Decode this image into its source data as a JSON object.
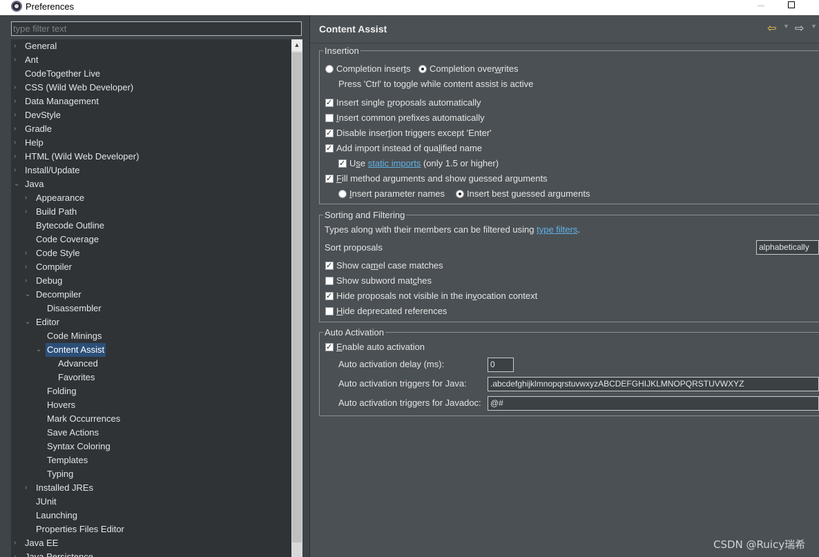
{
  "window": {
    "title": "Preferences"
  },
  "filter": {
    "placeholder": "type filter text"
  },
  "tree": [
    {
      "label": "General",
      "level": 0,
      "arrow": "›"
    },
    {
      "label": "Ant",
      "level": 0,
      "arrow": "›"
    },
    {
      "label": "CodeTogether Live",
      "level": 0,
      "arrow": ""
    },
    {
      "label": "CSS (Wild Web Developer)",
      "level": 0,
      "arrow": "›"
    },
    {
      "label": "Data Management",
      "level": 0,
      "arrow": "›"
    },
    {
      "label": "DevStyle",
      "level": 0,
      "arrow": "›"
    },
    {
      "label": "Gradle",
      "level": 0,
      "arrow": "›"
    },
    {
      "label": "Help",
      "level": 0,
      "arrow": "›"
    },
    {
      "label": "HTML (Wild Web Developer)",
      "level": 0,
      "arrow": "›"
    },
    {
      "label": "Install/Update",
      "level": 0,
      "arrow": "›"
    },
    {
      "label": "Java",
      "level": 0,
      "arrow": "⌄"
    },
    {
      "label": "Appearance",
      "level": 1,
      "arrow": "›"
    },
    {
      "label": "Build Path",
      "level": 1,
      "arrow": "›"
    },
    {
      "label": "Bytecode Outline",
      "level": 1,
      "arrow": ""
    },
    {
      "label": "Code Coverage",
      "level": 1,
      "arrow": ""
    },
    {
      "label": "Code Style",
      "level": 1,
      "arrow": "›"
    },
    {
      "label": "Compiler",
      "level": 1,
      "arrow": "›"
    },
    {
      "label": "Debug",
      "level": 1,
      "arrow": "›"
    },
    {
      "label": "Decompiler",
      "level": 1,
      "arrow": "⌄"
    },
    {
      "label": "Disassembler",
      "level": 2,
      "arrow": ""
    },
    {
      "label": "Editor",
      "level": 1,
      "arrow": "⌄"
    },
    {
      "label": "Code Minings",
      "level": 2,
      "arrow": ""
    },
    {
      "label": "Content Assist",
      "level": 2,
      "arrow": "⌄",
      "selected": true
    },
    {
      "label": "Advanced",
      "level": 3,
      "arrow": ""
    },
    {
      "label": "Favorites",
      "level": 3,
      "arrow": ""
    },
    {
      "label": "Folding",
      "level": 2,
      "arrow": ""
    },
    {
      "label": "Hovers",
      "level": 2,
      "arrow": ""
    },
    {
      "label": "Mark Occurrences",
      "level": 2,
      "arrow": ""
    },
    {
      "label": "Save Actions",
      "level": 2,
      "arrow": ""
    },
    {
      "label": "Syntax Coloring",
      "level": 2,
      "arrow": ""
    },
    {
      "label": "Templates",
      "level": 2,
      "arrow": ""
    },
    {
      "label": "Typing",
      "level": 2,
      "arrow": ""
    },
    {
      "label": "Installed JREs",
      "level": 1,
      "arrow": "›"
    },
    {
      "label": "JUnit",
      "level": 1,
      "arrow": ""
    },
    {
      "label": "Launching",
      "level": 1,
      "arrow": ""
    },
    {
      "label": "Properties Files Editor",
      "level": 1,
      "arrow": ""
    },
    {
      "label": "Java EE",
      "level": 0,
      "arrow": "›"
    },
    {
      "label": "Java Persistence",
      "level": 0,
      "arrow": "›"
    }
  ],
  "page": {
    "title": "Content Assist",
    "insertion": {
      "legend": "Insertion",
      "radio_inserts": {
        "pre": "Completion inser",
        "u": "t",
        "post": "s",
        "checked": false
      },
      "radio_overwrites": {
        "pre": "Completion over",
        "u": "w",
        "post": "rites",
        "checked": true
      },
      "toggle_hint": "Press 'Ctrl' to toggle while content assist is active",
      "cb_single": {
        "pre": "Insert single ",
        "u": "p",
        "post": "roposals automatically",
        "checked": true
      },
      "cb_common": {
        "pre": "",
        "u": "I",
        "post": "nsert common prefixes automatically",
        "checked": false
      },
      "cb_disable": {
        "pre": "Disable inser",
        "u": "t",
        "post": "ion triggers except 'Enter'",
        "checked": true
      },
      "cb_import": {
        "pre": "Add import instead of qua",
        "u": "l",
        "post": "ified name",
        "checked": true
      },
      "cb_static": {
        "pre": "U",
        "u": "s",
        "post": "e",
        "link": "static imports",
        "tail": " (only 1.5 or higher)",
        "checked": true
      },
      "cb_fill": {
        "pre": "",
        "u": "F",
        "post": "ill method arguments and show guessed arguments",
        "checked": true
      },
      "radio_param": {
        "pre": "",
        "u": "I",
        "post": "nsert parameter names",
        "checked": false
      },
      "radio_best": {
        "pre": "Insert best ",
        "u": "g",
        "post": "uessed arguments",
        "checked": true
      }
    },
    "sorting": {
      "legend": "Sorting and Filtering",
      "types_text": "Types along with their members can be filtered using ",
      "types_link": "type filters",
      "types_end": ".",
      "sort_label": "Sort proposals",
      "sort_value": "alphabetically",
      "cb_camel": {
        "pre": "Show ca",
        "u": "m",
        "post": "el case matches",
        "checked": true
      },
      "cb_subword": {
        "pre": "Show subword mat",
        "u": "c",
        "post": "hes",
        "checked": false
      },
      "cb_hide": {
        "pre": "Hide proposals not visible in the in",
        "u": "v",
        "post": "ocation context",
        "checked": true
      },
      "cb_deprecated": {
        "pre": "",
        "u": "H",
        "post": "ide deprecated references",
        "checked": false
      }
    },
    "auto": {
      "legend": "Auto Activation",
      "cb_enable": {
        "pre": "",
        "u": "E",
        "post": "nable auto activation",
        "checked": true
      },
      "delay_label": "Auto activation delay (ms):",
      "delay_value": "0",
      "java_label": "Auto activation triggers for Java:",
      "java_value": ".abcdefghijklmnopqrstuvwxyzABCDEFGHIJKLMNOPQRSTUVWXYZ",
      "javadoc_label": "Auto activation triggers for Javadoc:",
      "javadoc_value": "@#"
    }
  },
  "watermark": "CSDN @Ruicy瑞希"
}
